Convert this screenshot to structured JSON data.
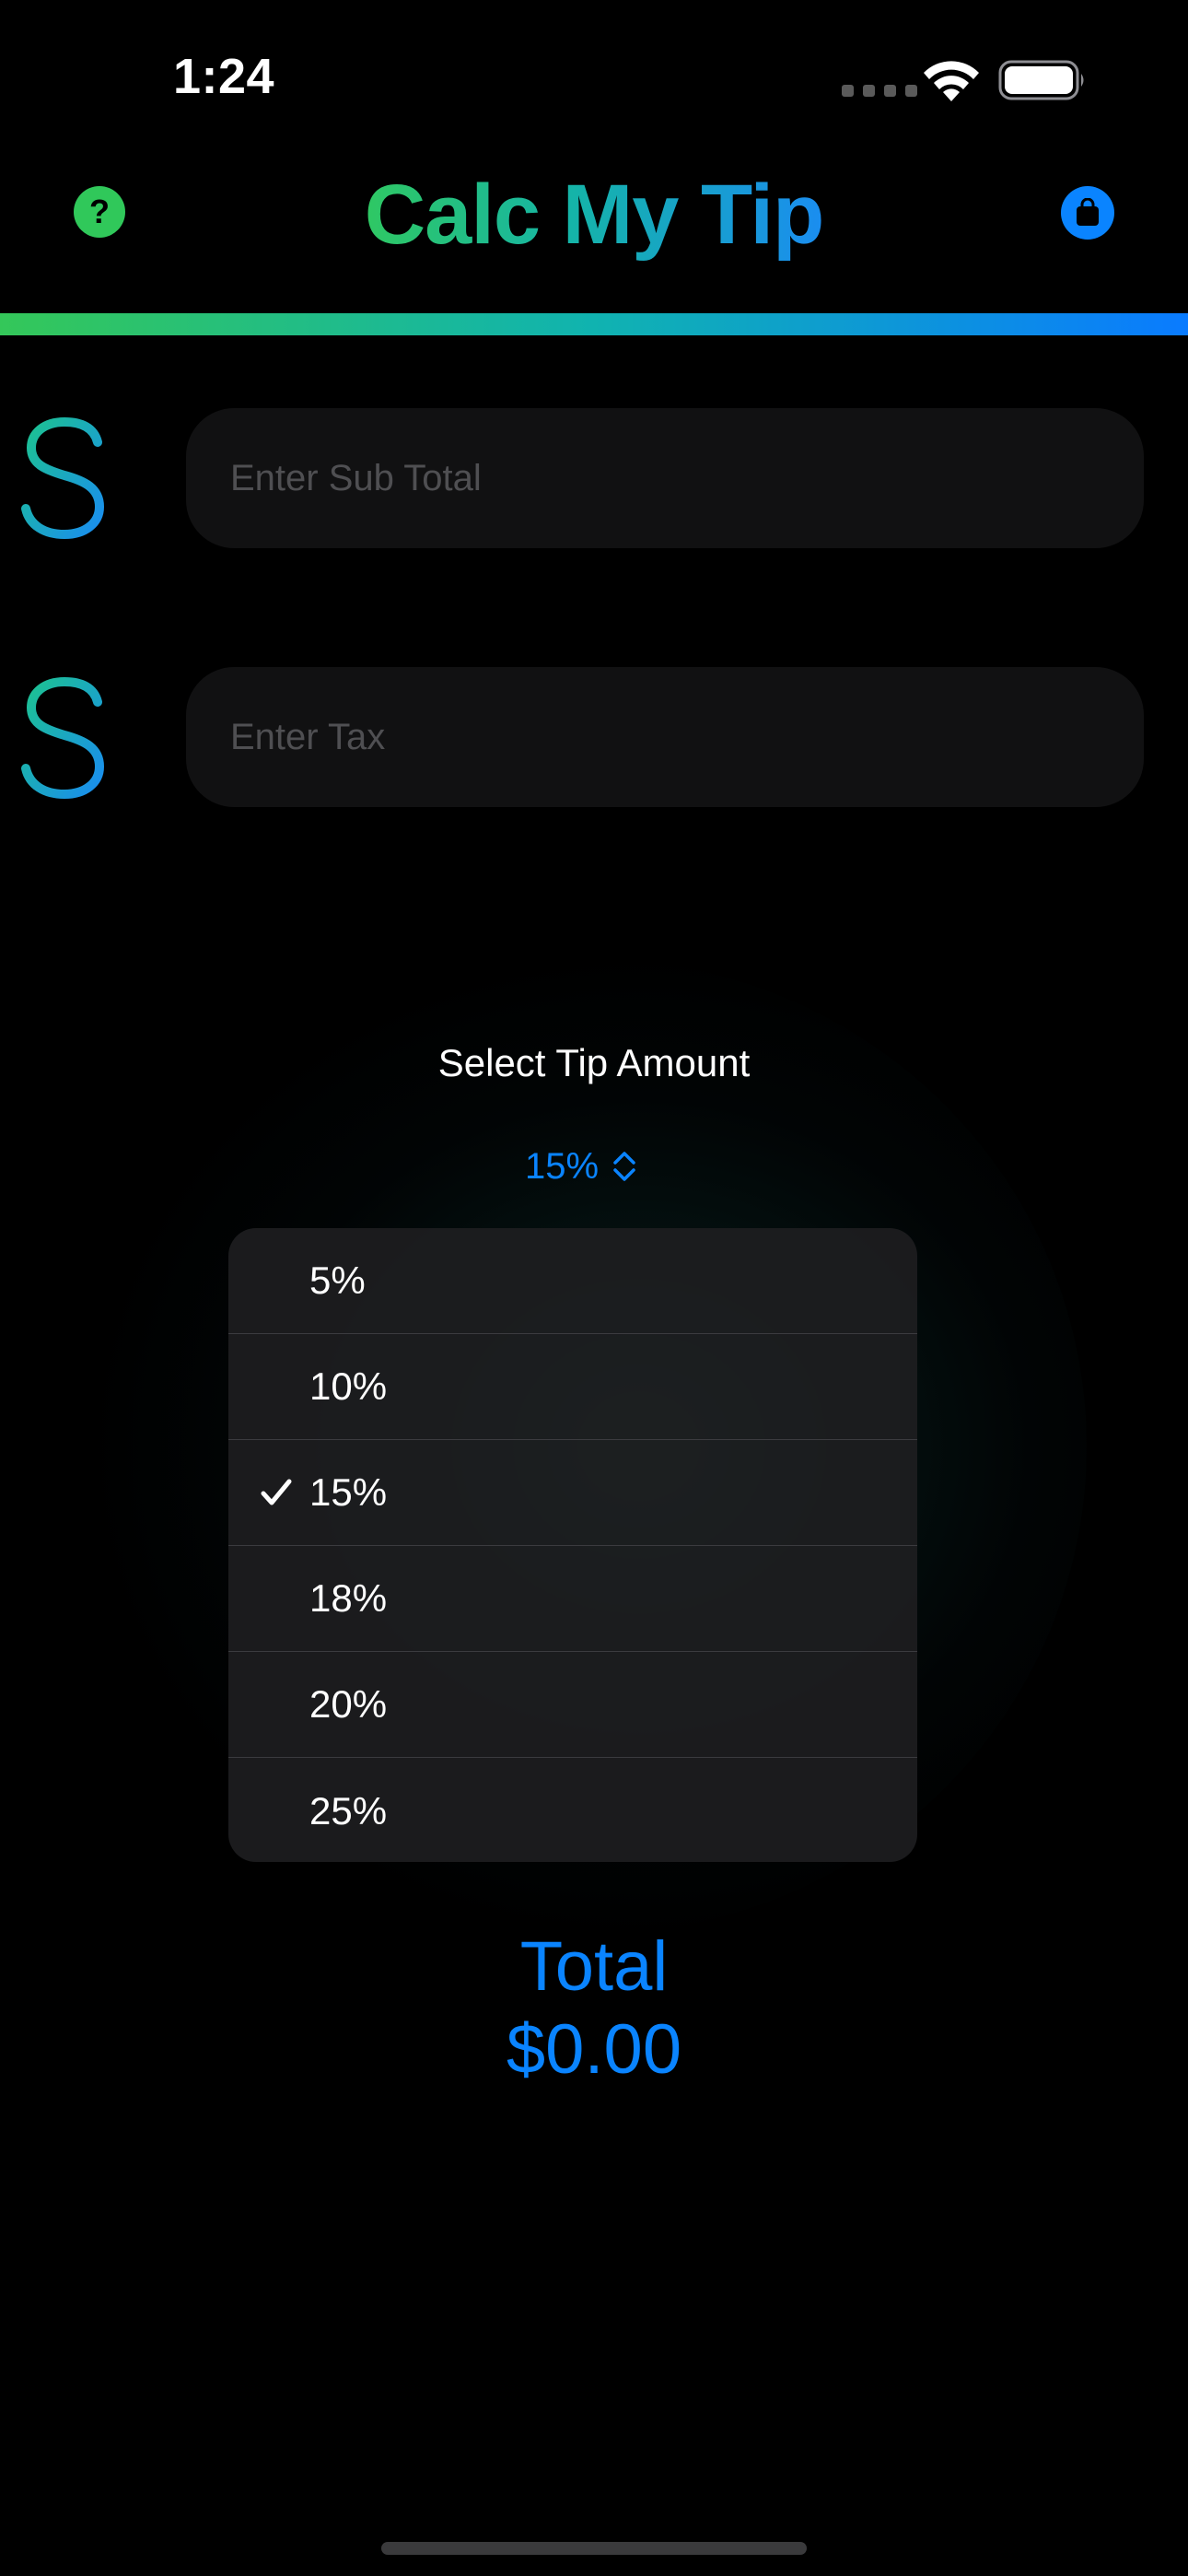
{
  "status_bar": {
    "time": "1:24"
  },
  "header": {
    "title": "Calc My Tip",
    "help_icon_glyph": "?",
    "help_icon": "question-circle-icon",
    "store_icon": "shopping-bag-icon"
  },
  "inputs": {
    "subtotal": {
      "placeholder": "Enter Sub Total",
      "value": "",
      "icon": "dollar-sign-icon"
    },
    "tax": {
      "placeholder": "Enter Tax",
      "value": "",
      "icon": "dollar-sign-icon"
    }
  },
  "tip": {
    "label": "Select Tip Amount",
    "selected": "15%",
    "options": [
      {
        "label": "5%",
        "selected": false
      },
      {
        "label": "10%",
        "selected": false
      },
      {
        "label": "15%",
        "selected": true
      },
      {
        "label": "18%",
        "selected": false
      },
      {
        "label": "20%",
        "selected": false
      },
      {
        "label": "25%",
        "selected": false
      }
    ]
  },
  "total": {
    "label": "Total",
    "value": "$0.00"
  },
  "colors": {
    "accent_blue": "#0a84ff",
    "accent_green": "#34c759",
    "teal": "#10b3b0",
    "background": "#000000",
    "field_background": "#111112"
  }
}
